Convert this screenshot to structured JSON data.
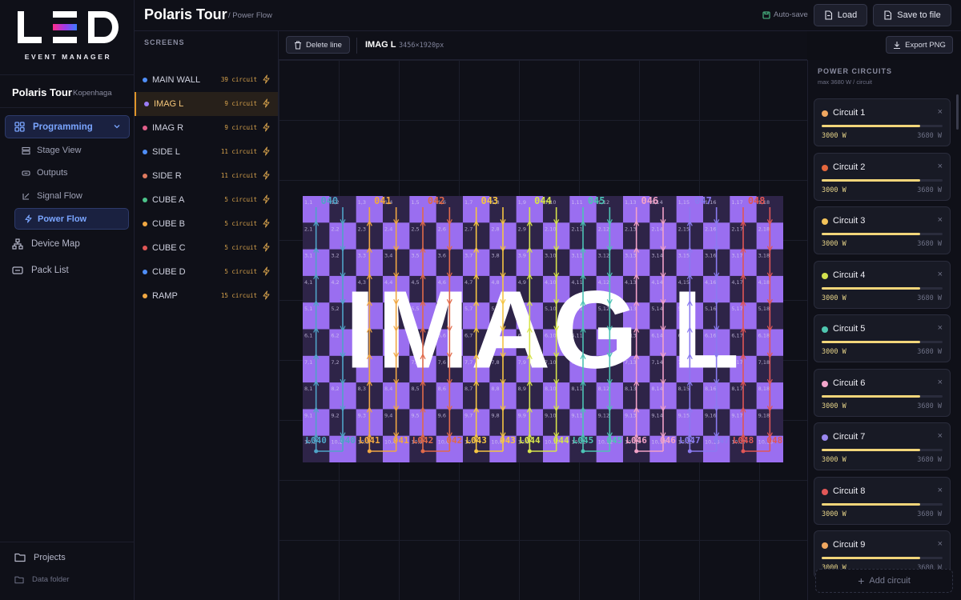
{
  "app": {
    "logo_text": "LED",
    "logo_subtitle": "EVENT MANAGER"
  },
  "project": {
    "name": "Polaris Tour",
    "city": "Kopenhaga"
  },
  "nav": {
    "programming": "Programming",
    "sub_items": [
      "Stage View",
      "Outputs",
      "Signal Flow",
      "Power Flow"
    ],
    "items": [
      "Device Map",
      "Pack List"
    ],
    "projects": "Projects",
    "data_folder": "Data folder"
  },
  "header": {
    "title": "Polaris Tour",
    "breadcrumb": "/ Power Flow",
    "autosave": "Auto-save",
    "load": "Load",
    "save": "Save to file"
  },
  "screens": {
    "title": "SCREENS",
    "items": [
      {
        "name": "MAIN WALL",
        "count": "39 circuit",
        "color": "#4f8ef7"
      },
      {
        "name": "IMAG L",
        "count": "9 circuit",
        "color": "#9b7cf6",
        "active": true
      },
      {
        "name": "IMAG R",
        "count": "9 circuit",
        "color": "#e25f8a"
      },
      {
        "name": "SIDE L",
        "count": "11 circuit",
        "color": "#4f8ef7"
      },
      {
        "name": "SIDE R",
        "count": "11 circuit",
        "color": "#e07a5f"
      },
      {
        "name": "CUBE A",
        "count": "5 circuit",
        "color": "#4cc38a"
      },
      {
        "name": "CUBE B",
        "count": "5 circuit",
        "color": "#f0a742"
      },
      {
        "name": "CUBE C",
        "count": "5 circuit",
        "color": "#e05656"
      },
      {
        "name": "CUBE D",
        "count": "5 circuit",
        "color": "#4f8ef7"
      },
      {
        "name": "RAMP",
        "count": "15 circuit",
        "color": "#f0a742"
      }
    ]
  },
  "toolbar": {
    "delete_line": "Delete line",
    "screen_name": "IMAG L",
    "resolution": "3456×1920px",
    "export": "Export PNG"
  },
  "canvas": {
    "screen_title": "IMAG L",
    "cols": 18,
    "rows": 10,
    "top_labels": [
      "040",
      "041",
      "042",
      "043",
      "044",
      "045",
      "046",
      "047",
      "048"
    ],
    "bottom_labels": [
      "L040",
      "040",
      "L041",
      "041",
      "L042",
      "042",
      "L043",
      "043",
      "L044",
      "044",
      "L045",
      "045",
      "L046",
      "046",
      "L047",
      "047",
      "L048",
      "048"
    ],
    "line_colors": [
      "#4fa3c7",
      "#f0a742",
      "#e06a4a",
      "#f5c542",
      "#d6e34a",
      "#4cc3b4",
      "#f2a2c8",
      "#8a7af0",
      "#e05656"
    ]
  },
  "circuits": {
    "title": "POWER CIRCUITS",
    "subtitle": "max 3680 W / circuit",
    "items": [
      {
        "name": "Circuit 1",
        "used": "3000 W",
        "max": "3680 W",
        "load": 0.815,
        "color": "#f0a760"
      },
      {
        "name": "Circuit 2",
        "used": "3000 W",
        "max": "3680 W",
        "load": 0.815,
        "color": "#e5673d"
      },
      {
        "name": "Circuit 3",
        "used": "3000 W",
        "max": "3680 W",
        "load": 0.815,
        "color": "#f3c35a"
      },
      {
        "name": "Circuit 4",
        "used": "3000 W",
        "max": "3680 W",
        "load": 0.815,
        "color": "#d2e04e"
      },
      {
        "name": "Circuit 5",
        "used": "3000 W",
        "max": "3680 W",
        "load": 0.815,
        "color": "#4fc7b0"
      },
      {
        "name": "Circuit 6",
        "used": "3000 W",
        "max": "3680 W",
        "load": 0.815,
        "color": "#f3a6cc"
      },
      {
        "name": "Circuit 7",
        "used": "3000 W",
        "max": "3680 W",
        "load": 0.815,
        "color": "#9a87f0"
      },
      {
        "name": "Circuit 8",
        "used": "3000 W",
        "max": "3680 W",
        "load": 0.815,
        "color": "#e25858"
      },
      {
        "name": "Circuit 9",
        "used": "3000 W",
        "max": "3680 W",
        "load": 0.815,
        "color": "#f0a760"
      }
    ],
    "close_glyph": "×",
    "add": "Add circuit"
  }
}
